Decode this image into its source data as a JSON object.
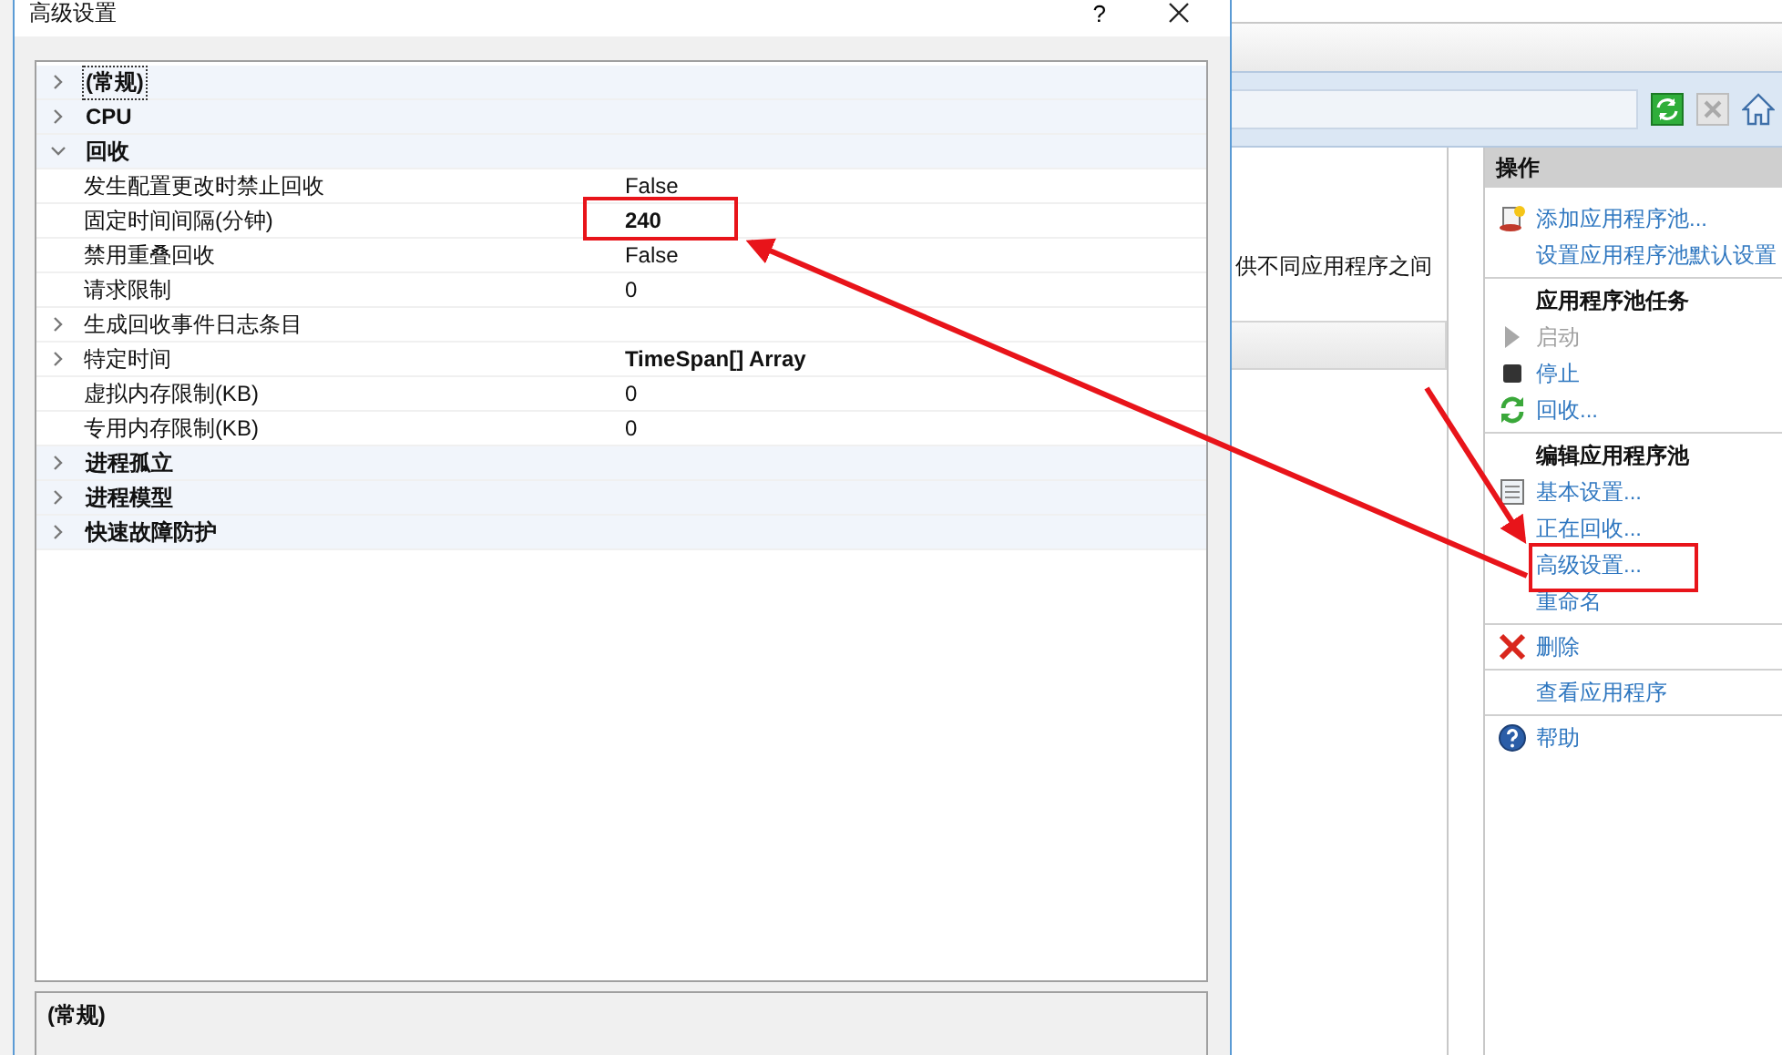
{
  "dialog": {
    "title": "高级设置",
    "help": "?",
    "categories": [
      {
        "name": "(常规)",
        "expanded": false,
        "selected": true
      },
      {
        "name": "CPU",
        "expanded": false,
        "selected": false
      },
      {
        "name": "回收",
        "expanded": true,
        "selected": false,
        "properties": [
          {
            "kind": "value",
            "name": "发生配置更改时禁止回收",
            "value": "False",
            "modified": false
          },
          {
            "kind": "value",
            "name": "固定时间间隔(分钟)",
            "value": "240",
            "modified": true
          },
          {
            "kind": "value",
            "name": "禁用重叠回收",
            "value": "False",
            "modified": false
          },
          {
            "kind": "value",
            "name": "请求限制",
            "value": "0",
            "modified": false
          },
          {
            "kind": "group",
            "name": "生成回收事件日志条目",
            "expanded": false
          },
          {
            "kind": "group",
            "name": "特定时间",
            "value": "TimeSpan[] Array",
            "modified": true,
            "expanded": false
          },
          {
            "kind": "value",
            "name": "虚拟内存限制(KB)",
            "value": "0",
            "modified": false
          },
          {
            "kind": "value",
            "name": "专用内存限制(KB)",
            "value": "0",
            "modified": false
          }
        ]
      },
      {
        "name": "进程孤立",
        "expanded": false,
        "selected": false
      },
      {
        "name": "进程模型",
        "expanded": false,
        "selected": false
      },
      {
        "name": "快速故障防护",
        "expanded": false,
        "selected": false
      }
    ],
    "description": {
      "title": "(常规)"
    }
  },
  "main_panel": {
    "text": "供不同应用程序之间"
  },
  "actions": {
    "title": "操作",
    "items": [
      {
        "kind": "add-pool",
        "label": "添加应用程序池...",
        "disabled": false
      },
      {
        "kind": "link",
        "label": "设置应用程序池默认设置",
        "disabled": false
      },
      {
        "kind": "separator"
      },
      {
        "kind": "heading",
        "label": "应用程序池任务"
      },
      {
        "kind": "start",
        "label": "启动",
        "disabled": true
      },
      {
        "kind": "stop",
        "label": "停止",
        "disabled": false
      },
      {
        "kind": "recycle",
        "label": "回收...",
        "disabled": false
      },
      {
        "kind": "separator"
      },
      {
        "kind": "heading",
        "label": "编辑应用程序池"
      },
      {
        "kind": "basic-settings",
        "label": "基本设置...",
        "disabled": false
      },
      {
        "kind": "link",
        "label": "正在回收...",
        "disabled": false
      },
      {
        "kind": "link",
        "label": "高级设置...",
        "disabled": false
      },
      {
        "kind": "link",
        "label": "重命名",
        "disabled": false
      },
      {
        "kind": "separator"
      },
      {
        "kind": "delete",
        "label": "删除",
        "disabled": false
      },
      {
        "kind": "separator"
      },
      {
        "kind": "link",
        "label": "查看应用程序",
        "disabled": false
      },
      {
        "kind": "separator"
      },
      {
        "kind": "help",
        "label": "帮助",
        "disabled": false
      }
    ]
  }
}
